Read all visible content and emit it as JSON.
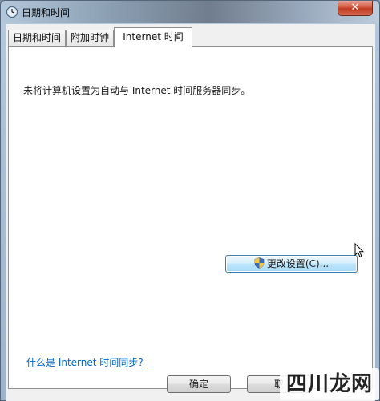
{
  "window": {
    "title": "日期和时间",
    "close_label": "✕"
  },
  "tabs": [
    {
      "label": "日期和时间",
      "active": false
    },
    {
      "label": "附加时钟",
      "active": false
    },
    {
      "label": "Internet 时间",
      "active": true
    }
  ],
  "panel": {
    "status_text": "未将计算机设置为自动与 Internet 时间服务器同步。",
    "change_button_label": "更改设置(C)...",
    "change_button_icon": "uac-shield-icon",
    "help_link": "什么是 Internet 时间同步?"
  },
  "footer": {
    "ok_label": "确定",
    "cancel_label": "取"
  },
  "watermark": {
    "text": "四川龙网"
  },
  "colors": {
    "link": "#0066cc",
    "button_focus_border": "#3c7fb1",
    "close_button": "#c03a20"
  }
}
